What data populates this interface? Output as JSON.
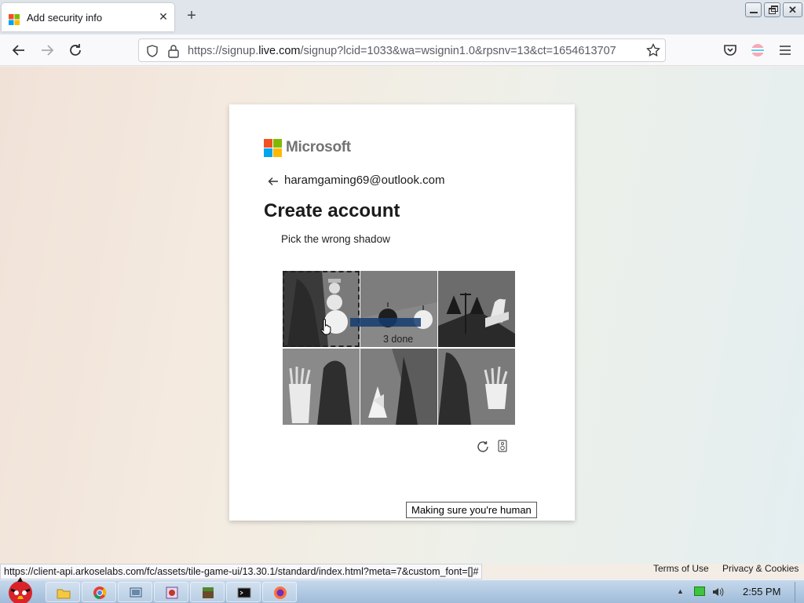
{
  "browser": {
    "tab_title": "Add security info",
    "tab_close": "✕",
    "new_tab": "+",
    "url_prefix": "https://signup.",
    "url_domain": "live.com",
    "url_rest": "/signup?lcid=1033&wa=wsignin1.0&rpsnv=13&ct=1654613707"
  },
  "card": {
    "brand": "Microsoft",
    "email": "haramgaming69@outlook.com",
    "heading": "Create account",
    "instruction": "Pick the wrong shadow",
    "progress_text": "3 done",
    "tooltip": "Making sure you're human"
  },
  "puzzle": {
    "tiles": [
      "snowman",
      "apples",
      "scales",
      "fries",
      "christmas-tree",
      "fries"
    ],
    "selected_tile": 0
  },
  "footer": {
    "status_url": "https://client-api.arkoselabs.com/fc/assets/tile-game-ui/13.30.1/standard/index.html?meta=7&custom_font=[]#",
    "terms": "Terms of Use",
    "privacy": "Privacy & Cookies"
  },
  "taskbar": {
    "clock": "2:55 PM",
    "apps": [
      "folder-icon",
      "chrome-icon",
      "screenshot-icon",
      "paint-icon",
      "minecraft-icon",
      "cmd-icon",
      "firefox-icon"
    ]
  },
  "colors": {
    "ms_red": "#f25022",
    "ms_green": "#7fba00",
    "ms_blue": "#00a4ef",
    "ms_yellow": "#ffb900",
    "progress": "#143c6e"
  }
}
